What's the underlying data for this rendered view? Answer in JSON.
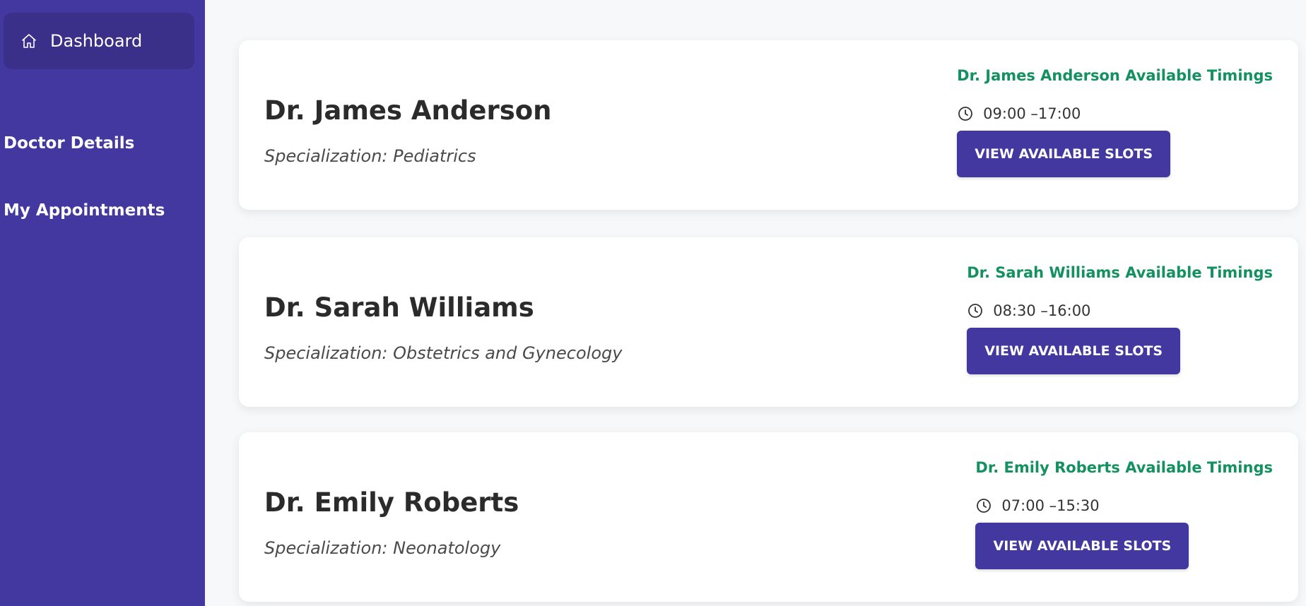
{
  "sidebar": {
    "dashboard_label": "Dashboard",
    "doctor_details_label": "Doctor Details",
    "my_appointments_label": "My Appointments",
    "icons": {
      "dashboard": "home-icon"
    }
  },
  "doctors": [
    {
      "name": "Dr. James Anderson",
      "specialization_label": "Specialization",
      "specialization": "Pediatrics",
      "timings_title": "Dr. James Anderson Available Timings",
      "timing": "09:00 –17:00",
      "button_label": "VIEW AVAILABLE SLOTS"
    },
    {
      "name": "Dr. Sarah Williams",
      "specialization_label": "Specialization",
      "specialization": "Obstetrics and Gynecology",
      "timings_title": "Dr. Sarah Williams Available Timings",
      "timing": "08:30 –16:00",
      "button_label": "VIEW AVAILABLE SLOTS"
    },
    {
      "name": "Dr. Emily Roberts",
      "specialization_label": "Specialization",
      "specialization": "Neonatology",
      "timings_title": "Dr. Emily Roberts Available Timings",
      "timing": "07:00 –15:30",
      "button_label": "VIEW AVAILABLE SLOTS"
    }
  ],
  "colors": {
    "sidebar": "#43389f",
    "accent_green": "#139160",
    "button": "#43389f"
  }
}
